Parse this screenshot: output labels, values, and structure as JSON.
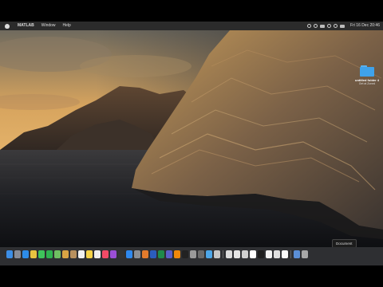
{
  "menubar": {
    "app_name": "MATLAB",
    "items": [
      "Window",
      "Help"
    ],
    "clock": "Fri 16 Dec  20:46"
  },
  "desktop": {
    "folder": {
      "name": "untitled folder 4",
      "subtitle": "Get at Zoned"
    }
  },
  "tooltip": {
    "text": "Document"
  },
  "dock": {
    "icons": [
      {
        "name": "finder-icon",
        "color": "#3c8ee6"
      },
      {
        "name": "launchpad-icon",
        "color": "#888c96"
      },
      {
        "name": "safari-icon",
        "color": "#2d8ce8"
      },
      {
        "name": "chrome-icon",
        "color": "#e8c340"
      },
      {
        "name": "messages-icon",
        "color": "#3ec45b"
      },
      {
        "name": "facetime-icon",
        "color": "#2fb24f"
      },
      {
        "name": "maps-icon",
        "color": "#6fbf62"
      },
      {
        "name": "photos-icon",
        "color": "#d9a444"
      },
      {
        "name": "contacts-icon",
        "color": "#b8905e"
      },
      {
        "name": "calendar-icon",
        "color": "#f0f0f0"
      },
      {
        "name": "notes-icon",
        "color": "#f4d247"
      },
      {
        "name": "reminders-icon",
        "color": "#eeeeee"
      },
      {
        "name": "music-icon",
        "color": "#f24a66"
      },
      {
        "name": "podcasts-icon",
        "color": "#9b4fd6"
      },
      {
        "name": "tv-icon",
        "color": "#333333"
      },
      {
        "name": "app-store-icon",
        "color": "#2e88ee"
      },
      {
        "name": "system-preferences-icon",
        "color": "#8b8e93"
      },
      {
        "name": "matlab-icon",
        "color": "#e37b2c"
      },
      {
        "name": "word-icon",
        "color": "#2b5dbd"
      },
      {
        "name": "excel-icon",
        "color": "#1f8a4a"
      },
      {
        "name": "teams-icon",
        "color": "#5b5fc7"
      },
      {
        "name": "vlc-icon",
        "color": "#f0880a"
      },
      {
        "name": "terminal-icon",
        "color": "#222222"
      },
      {
        "name": "disk-utility-icon",
        "color": "#9a9a9a"
      },
      {
        "name": "help-icon",
        "color": "#6a6a6a"
      },
      {
        "name": "preview-icon",
        "color": "#4da6e8"
      },
      {
        "name": "screenshot-icon",
        "color": "#c6c6c6"
      },
      {
        "name": "window-thumb-1-icon",
        "color": "#dddddd"
      },
      {
        "name": "window-thumb-2-icon",
        "color": "#e6e6e6"
      },
      {
        "name": "window-thumb-3-icon",
        "color": "#d0d0d0"
      },
      {
        "name": "window-thumb-4-icon",
        "color": "#ffffff"
      },
      {
        "name": "window-thumb-5-icon",
        "color": "#1e1e1e"
      },
      {
        "name": "window-thumb-6-icon",
        "color": "#f2f2f2"
      },
      {
        "name": "window-thumb-7-icon",
        "color": "#e0e0e0"
      },
      {
        "name": "window-thumb-8-icon",
        "color": "#fafafa"
      },
      {
        "name": "downloads-icon",
        "color": "#5b8fd6"
      },
      {
        "name": "trash-icon",
        "color": "#a8a8a8"
      }
    ]
  }
}
